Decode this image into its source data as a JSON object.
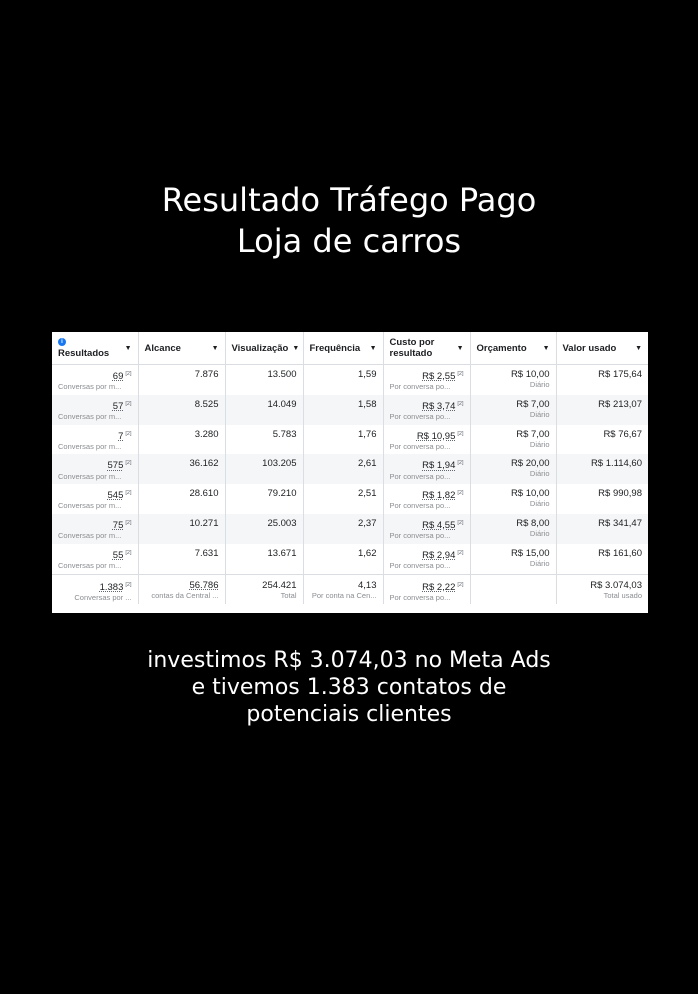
{
  "heading": {
    "line1": "Resultado Tráfego Pago",
    "line2": "Loja de carros"
  },
  "table": {
    "columns": [
      "Resultados",
      "Alcance",
      "Visualização",
      "Frequência",
      "Custo por resultado",
      "Orçamento",
      "Valor usado"
    ],
    "rows": [
      {
        "resultado": "69",
        "resultado_sub": "Conversas por m...",
        "alcance": "7.876",
        "visualizacao": "13.500",
        "frequencia": "1,59",
        "custo": "R$ 2,55",
        "custo_sub": "Por conversa po...",
        "orcamento": "R$ 10,00",
        "orcamento_sub": "Diário",
        "valor": "R$ 175,64"
      },
      {
        "resultado": "57",
        "resultado_sub": "Conversas por m...",
        "alcance": "8.525",
        "visualizacao": "14.049",
        "frequencia": "1,58",
        "custo": "R$ 3,74",
        "custo_sub": "Por conversa po...",
        "orcamento": "R$ 7,00",
        "orcamento_sub": "Diário",
        "valor": "R$ 213,07"
      },
      {
        "resultado": "7",
        "resultado_sub": "Conversas por m...",
        "alcance": "3.280",
        "visualizacao": "5.783",
        "frequencia": "1,76",
        "custo": "R$ 10,95",
        "custo_sub": "Por conversa po...",
        "orcamento": "R$ 7,00",
        "orcamento_sub": "Diário",
        "valor": "R$ 76,67"
      },
      {
        "resultado": "575",
        "resultado_sub": "Conversas por m...",
        "alcance": "36.162",
        "visualizacao": "103.205",
        "frequencia": "2,61",
        "custo": "R$ 1,94",
        "custo_sub": "Por conversa po...",
        "orcamento": "R$ 20,00",
        "orcamento_sub": "Diário",
        "valor": "R$ 1.114,60"
      },
      {
        "resultado": "545",
        "resultado_sub": "Conversas por m...",
        "alcance": "28.610",
        "visualizacao": "79.210",
        "frequencia": "2,51",
        "custo": "R$ 1,82",
        "custo_sub": "Por conversa po...",
        "orcamento": "R$ 10,00",
        "orcamento_sub": "Diário",
        "valor": "R$ 990,98"
      },
      {
        "resultado": "75",
        "resultado_sub": "Conversas por m...",
        "alcance": "10.271",
        "visualizacao": "25.003",
        "frequencia": "2,37",
        "custo": "R$ 4,55",
        "custo_sub": "Por conversa po...",
        "orcamento": "R$ 8,00",
        "orcamento_sub": "Diário",
        "valor": "R$ 341,47"
      },
      {
        "resultado": "55",
        "resultado_sub": "Conversas por m...",
        "alcance": "7.631",
        "visualizacao": "13.671",
        "frequencia": "1,62",
        "custo": "R$ 2,94",
        "custo_sub": "Por conversa po...",
        "orcamento": "R$ 15,00",
        "orcamento_sub": "Diário",
        "valor": "R$ 161,60"
      }
    ],
    "total": {
      "resultado": "1.383",
      "resultado_sub": "Conversas por ...",
      "alcance": "56.786",
      "alcance_sub": "contas da Central ...",
      "visualizacao": "254.421",
      "visualizacao_sub": "Total",
      "frequencia": "4,13",
      "frequencia_sub": "Por conta na Cen...",
      "custo": "R$ 2,22",
      "custo_sub": "Por conversa po...",
      "valor": "R$ 3.074,03",
      "valor_sub": "Total usado"
    },
    "footnote_mark": "[2]"
  },
  "caption": {
    "line1": "investimos R$ 3.074,03 no Meta Ads",
    "line2": "e tivemos 1.383 contatos de",
    "line3": "potenciais clientes"
  },
  "colors": {
    "background": "#000000",
    "info_icon": "#1877f2",
    "muted_text": "#8a8d91"
  }
}
